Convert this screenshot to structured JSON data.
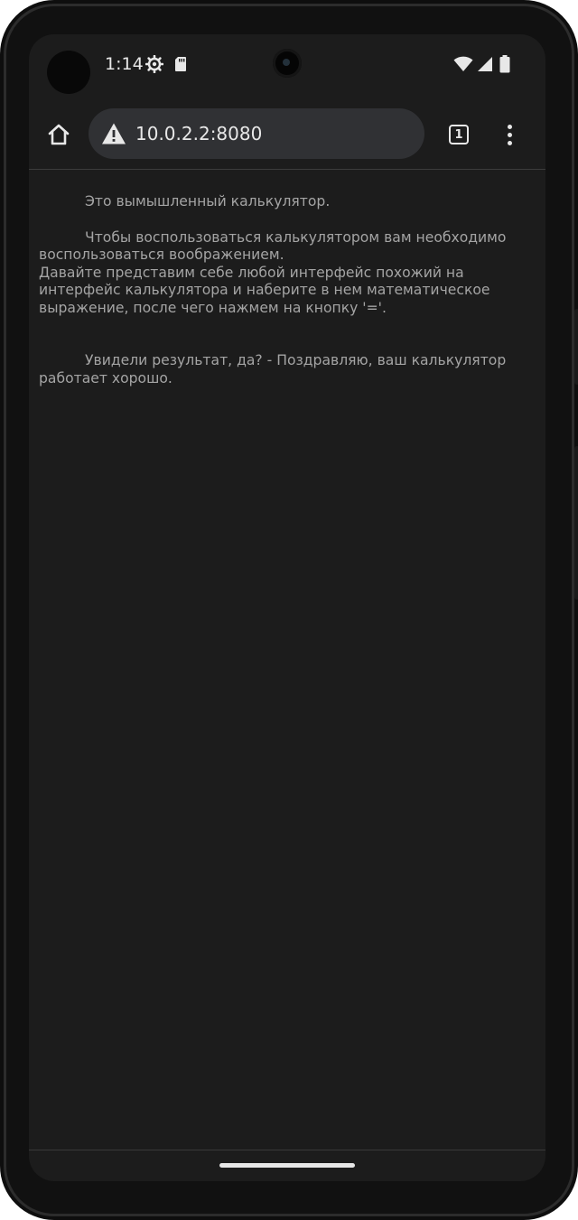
{
  "status_bar": {
    "time": "1:14",
    "icons": [
      "settings-icon",
      "sdcard-icon",
      "wifi-icon",
      "signal-icon",
      "battery-icon"
    ]
  },
  "browser": {
    "url": "10.0.2.2:8080",
    "tab_count": "1",
    "security_icon": "warning-icon"
  },
  "page": {
    "paragraph_1": "Это вымышленный калькулятор.",
    "paragraph_2_line_1": "Чтобы воспользоваться калькулятором вам необходимо воспользоваться воображением.",
    "paragraph_2_line_2": "Давайте представим себе любой интерфейс похожий на интерфейс калькулятора и наберите в нем математическое выражение, после чего нажмем на кнопку '='.",
    "paragraph_3": "Увидели результат, да? - Поздравляю, ваш калькулятор работает хорошо."
  },
  "colors": {
    "screen_background": "#1c1c1c",
    "text": "#a4a4a4",
    "url_bar": "#303134"
  }
}
